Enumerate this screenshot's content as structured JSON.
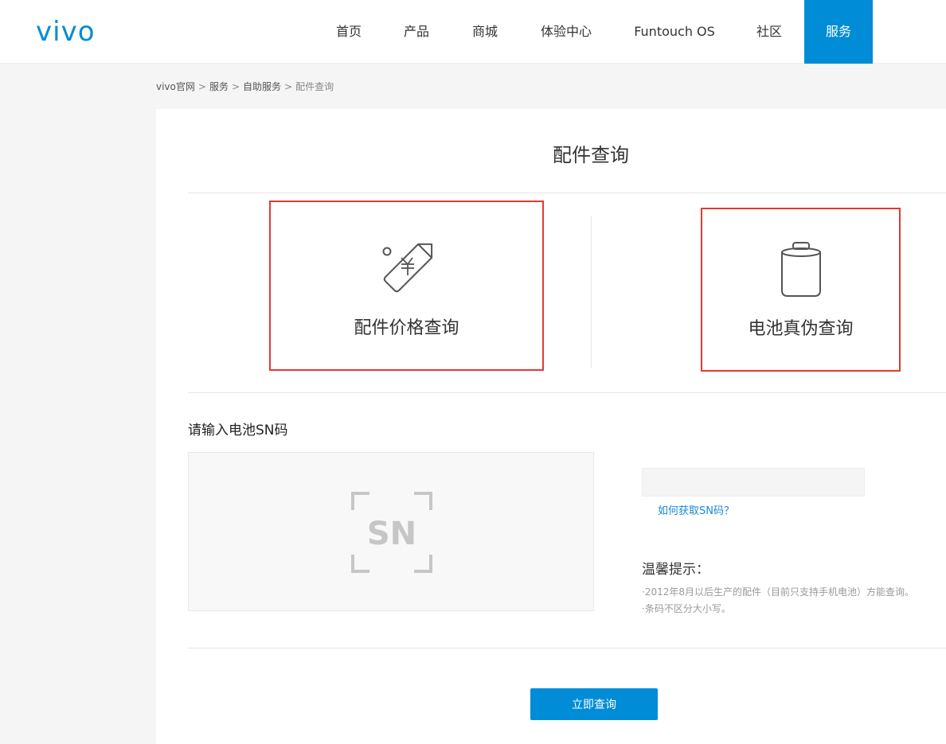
{
  "header": {
    "logo_text": "vivo",
    "brand_color": "#008cd6",
    "nav": [
      {
        "label": "首页"
      },
      {
        "label": "产品"
      },
      {
        "label": "商城"
      },
      {
        "label": "体验中心"
      },
      {
        "label": "Funtouch OS"
      },
      {
        "label": "社区"
      },
      {
        "label": "服务",
        "active": true
      }
    ]
  },
  "breadcrumb": {
    "items": [
      "vivo官网",
      "服务",
      "自助服务",
      "配件查询"
    ],
    "separator": ">"
  },
  "main": {
    "title": "配件查询",
    "cards": [
      {
        "label": "配件价格查询",
        "icon": "price-tag-icon"
      },
      {
        "label": "电池真伪查询",
        "icon": "battery-icon"
      }
    ],
    "highlight_color": "#e53935",
    "sn_section": {
      "title": "请输入电池SN码",
      "image_text": "SN",
      "input_value": "",
      "input_placeholder": "",
      "help_link": "如何获取SN码？"
    },
    "tips": {
      "title": "温馨提示：",
      "lines": [
        "·2012年8月以后生产的配件（目前只支持手机电池）方能查询。",
        "·条码不区分大小写。"
      ]
    },
    "submit_label": "立即查询"
  }
}
